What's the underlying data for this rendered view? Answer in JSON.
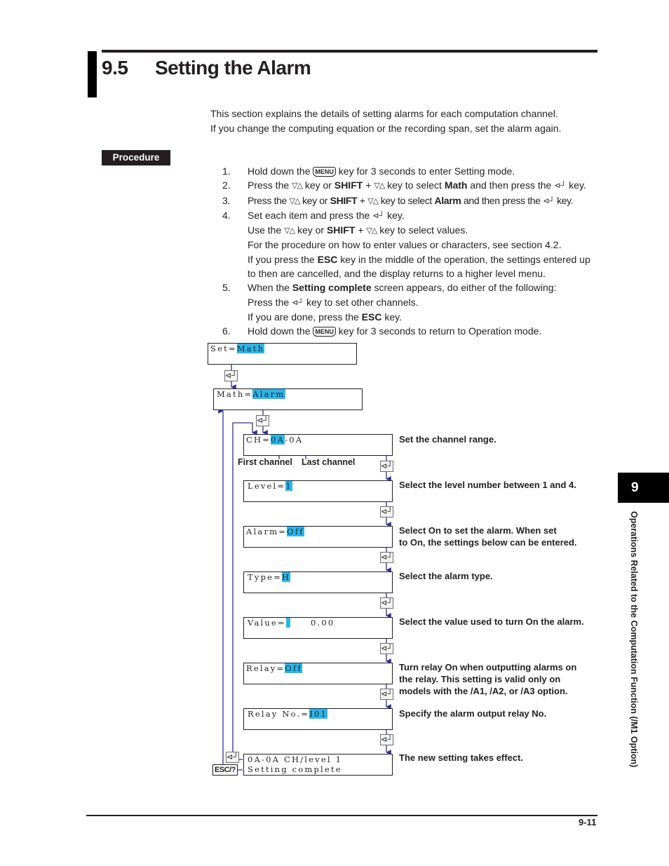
{
  "header": {
    "section_number": "9.5",
    "section_title": "Setting the Alarm"
  },
  "intro": [
    "This section explains the details of setting alarms for each computation channel.",
    "If you change the computing equation or the recording span, set the alarm again."
  ],
  "procedure_label": "Procedure",
  "keys": {
    "menu": "MENU",
    "updown": "▽△",
    "enter": "⊲┘",
    "esc": "ESC/?"
  },
  "steps": {
    "s1": {
      "num": "1.",
      "a": "Hold down the",
      "b": "key for 3 seconds to enter Setting mode."
    },
    "s2": {
      "num": "2.",
      "a": "Press the",
      "b": "key or",
      "shift": "SHIFT",
      "plus": "+",
      "c": "key to select",
      "target": "Math",
      "d": "and then press the",
      "e": "key."
    },
    "s3": {
      "num": "3.",
      "a": "Press the",
      "b": "key or",
      "shift": "SHIFT",
      "plus": "+",
      "c": "key to select",
      "target": "Alarm",
      "d": "and then press the",
      "e": "key."
    },
    "s4": {
      "num": "4.",
      "line1a": "Set each item and press the",
      "line1b": "key.",
      "line2a": "Use the",
      "line2b": "key or",
      "line2shift": "SHIFT",
      "line2plus": "+",
      "line2c": "key to select values.",
      "line3": "For the procedure on how to enter values or characters, see section 4.2.",
      "line4a": "If you press the",
      "line4esc": "ESC",
      "line4b": "key in the middle of the operation, the settings entered up",
      "line5": "to then are cancelled, and the display returns to a higher level menu."
    },
    "s5": {
      "num": "5.",
      "line1a": "When the",
      "line1bold": "Setting complete",
      "line1b": "screen appears, do either of the following:",
      "line2a": "Press the",
      "line2b": "key to set other channels.",
      "line3a": "If you are done, press the",
      "line3esc": "ESC",
      "line3b": "key."
    },
    "s6": {
      "num": "6.",
      "a": "Hold down the",
      "b": "key for 3 seconds to return to Operation mode."
    }
  },
  "diagram": {
    "screens": {
      "set_math": {
        "label": "Set=",
        "value": "Math"
      },
      "math_alarm": {
        "label": "Math=",
        "value": "Alarm"
      },
      "ch": {
        "label": "CH=",
        "value": "0A",
        "rest": "-0A"
      },
      "level": {
        "label": "Level=",
        "value": "1"
      },
      "alarm": {
        "label": "Alarm=",
        "value": "Off"
      },
      "type": {
        "label": "Type=",
        "value": "H"
      },
      "value": {
        "label": "Value=",
        "value": " ",
        "rest": "     0.00"
      },
      "relay": {
        "label": "Relay=",
        "value": "Off"
      },
      "relay_no": {
        "label": "Relay No.=",
        "value": "I01"
      },
      "complete": {
        "line1": "0A-0A CH/level 1",
        "line2": "Setting complete"
      }
    },
    "captions": {
      "first_channel": "First channel",
      "last_channel": "Last channel"
    },
    "descriptions": {
      "ch": "Set the channel range.",
      "level": "Select the level number between 1 and 4.",
      "alarm1": "Select On to set the alarm.  When set",
      "alarm2": "to On, the settings below can be entered.",
      "type": "Select the alarm type.",
      "value": "Select the value used to turn On the alarm.",
      "relay1": "Turn relay On when outputting alarms on",
      "relay2": "the relay.  This setting is valid only on",
      "relay3": "models with the /A1, /A2, or /A3 option.",
      "relay_no": "Specify the alarm output relay No.",
      "complete": "The new setting takes effect."
    },
    "colors": {
      "highlight": "#29b6ec",
      "flow_line": "#2e3192"
    }
  },
  "chapter_tab": {
    "number": "9",
    "title": "Operations Related to the Computation Function (/M1 Option)"
  },
  "footer": {
    "page_number": "9-11"
  }
}
